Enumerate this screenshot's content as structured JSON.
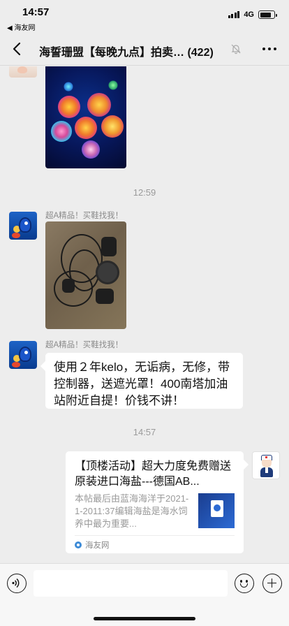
{
  "status_bar": {
    "time": "14:57",
    "back_app": "◀ 海友网",
    "network": "4G"
  },
  "nav": {
    "title": "海誓珊盟【每晚九点】拍卖… (422)",
    "back_icon": "chevron-left-icon",
    "mute_icon": "bell-off-icon",
    "more_icon": "more-icon"
  },
  "messages": {
    "time_1": "12:59",
    "sender_1": "超A精品！买鞋找我！",
    "sender_2": "超A精品！买鞋找我！",
    "text_message": "使用２年kelo，无诟病，无修，带控制器，送遮光罩！400南塔加油站附近自提！价钱不讲！",
    "time_2": "14:57"
  },
  "link_card": {
    "title": "【顶楼活动】超大力度免费赠送原装进口海盐---德国AB...",
    "body": "本帖最后由蓝海海洋于2021-1-2011:37编辑海盐是海水饲养中最为重要...",
    "source": "海友网"
  },
  "input_bar": {
    "voice_icon": "voice-icon",
    "emoji_icon": "emoji-icon",
    "plus_icon": "plus-icon"
  }
}
